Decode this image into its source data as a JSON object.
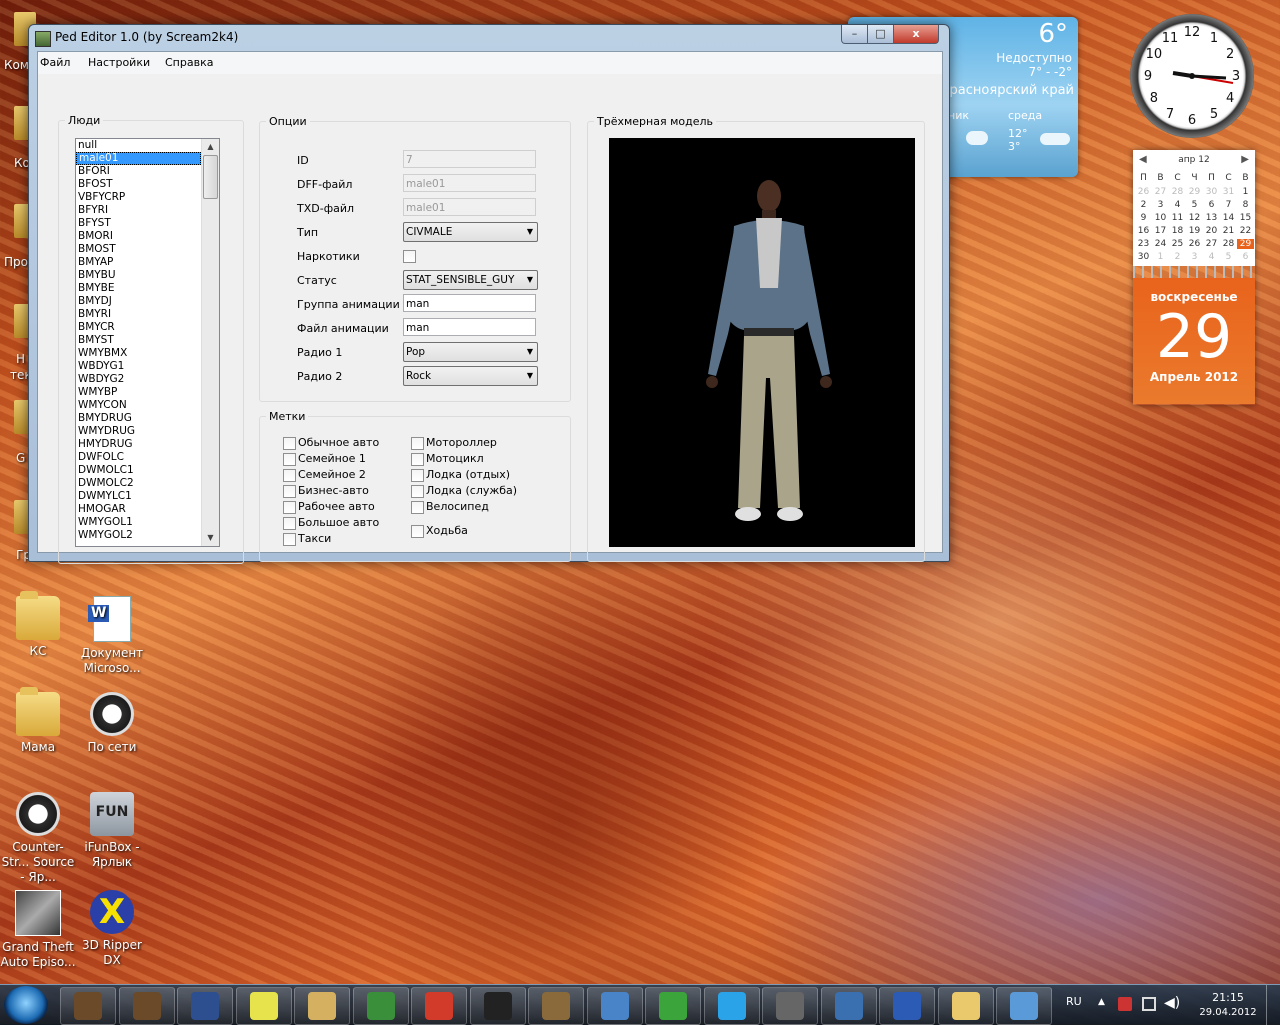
{
  "desktop": {
    "left_partial": [
      "Ком",
      "Ко",
      "Про",
      "Н",
      "тек",
      "G",
      "Гр"
    ],
    "icons": [
      {
        "label": "КС",
        "kind": "folder"
      },
      {
        "label": "Документ Microso...",
        "kind": "doc"
      },
      {
        "label": "Мама",
        "kind": "folder"
      },
      {
        "label": "По сети",
        "kind": "cs"
      },
      {
        "label": "Counter-Str... Source - Яр...",
        "kind": "cs"
      },
      {
        "label": "iFunBox - Ярлык",
        "kind": "fun"
      },
      {
        "label": "Grand Theft Auto Episo...",
        "kind": "gta"
      },
      {
        "label": "3D Ripper DX",
        "kind": "x"
      }
    ]
  },
  "window": {
    "title": "Ped Editor 1.0 (by Scream2k4)",
    "controls": {
      "minimize": "–",
      "maximize": "□",
      "close": "x"
    },
    "menu": [
      "Файл",
      "Настройки",
      "Справка"
    ],
    "people": {
      "title": "Люди",
      "selected": "male01",
      "items": [
        "null",
        "male01",
        "BFORI",
        "BFOST",
        "VBFYCRP",
        "BFYRI",
        "BFYST",
        "BMORI",
        "BMOST",
        "BMYAP",
        "BMYBU",
        "BMYBE",
        "BMYDJ",
        "BMYRI",
        "BMYCR",
        "BMYST",
        "WMYBMX",
        "WBDYG1",
        "WBDYG2",
        "WMYBP",
        "WMYCON",
        "BMYDRUG",
        "WMYDRUG",
        "HMYDRUG",
        "DWFOLC",
        "DWMOLC1",
        "DWMOLC2",
        "DWMYLC1",
        "HMOGAR",
        "WMYGOL1",
        "WMYGOL2"
      ]
    },
    "options": {
      "title": "Опции",
      "id_label": "ID",
      "id_value": "7",
      "dff_label": "DFF-файл",
      "dff_value": "male01",
      "txd_label": "TXD-файл",
      "txd_value": "male01",
      "type_label": "Тип",
      "type_value": "CIVMALE",
      "drugs_label": "Наркотики",
      "drugs_checked": false,
      "status_label": "Статус",
      "status_value": "STAT_SENSIBLE_GUY",
      "anim_group_label": "Группа анимации",
      "anim_group_value": "man",
      "anim_file_label": "Файл анимации",
      "anim_file_value": "man",
      "radio1_label": "Радио 1",
      "radio1_value": "Pop",
      "radio2_label": "Радио 2",
      "radio2_value": "Rock"
    },
    "tags": {
      "title": "Метки",
      "left": [
        "Обычное авто",
        "Семейное 1",
        "Семейное 2",
        "Бизнес-авто",
        "Рабочее авто",
        "Большое авто",
        "Такси"
      ],
      "right": [
        "Мотороллер",
        "Мотоцикл",
        "Лодка (отдых)",
        "Лодка (служба)",
        "Велосипед"
      ],
      "walk": "Ходьба"
    },
    "model": {
      "title": "Трёхмерная модель"
    }
  },
  "gadgets": {
    "weather": {
      "temp": "6°",
      "status": "Недоступно",
      "range": "7° - -2°",
      "region": "Красноярский край",
      "day1": "ник",
      "day2": "среда",
      "day2_temps": "12° 3°"
    },
    "clock": {
      "numbers": [
        "12",
        "1",
        "2",
        "3",
        "4",
        "5",
        "6",
        "7",
        "8",
        "9",
        "10",
        "11"
      ]
    },
    "calendar": {
      "month": "апр 12",
      "weekdays": [
        "П",
        "В",
        "С",
        "Ч",
        "П",
        "С",
        "В"
      ],
      "days": [
        "26",
        "27",
        "28",
        "29",
        "30",
        "31",
        "1",
        "2",
        "3",
        "4",
        "5",
        "6",
        "7",
        "8",
        "9",
        "10",
        "11",
        "12",
        "13",
        "14",
        "15",
        "16",
        "17",
        "18",
        "19",
        "20",
        "21",
        "22",
        "23",
        "24",
        "25",
        "26",
        "27",
        "28",
        "29",
        "30",
        "1",
        "2",
        "3",
        "4",
        "5",
        "6"
      ],
      "weekday_name": "воскресенье",
      "day": "29",
      "month_year": "Апрель 2012"
    }
  },
  "taskbar": {
    "lang": "RU",
    "time": "21:15",
    "date": "29.04.2012",
    "buttons": [
      "gta-ped-1",
      "gta-ped-2",
      "ii-app",
      "winrar",
      "sketch",
      "notepad",
      "chrome",
      "steam",
      "gta-image",
      "network",
      "agent",
      "skype",
      "cs-game",
      "updater",
      "word",
      "explorer",
      "image-viewer"
    ],
    "colors": [
      "#6b4a2a",
      "#6b4a2a",
      "#2e4f8f",
      "#e6e34d",
      "#d5b060",
      "#3a8f3a",
      "#d23a2a",
      "#222",
      "#8a6a3a",
      "#4a84c8",
      "#3ba53b",
      "#2aa3e8",
      "#666",
      "#3a6fb0",
      "#2b5bb5",
      "#e9c96c",
      "#5a9ad8"
    ]
  }
}
